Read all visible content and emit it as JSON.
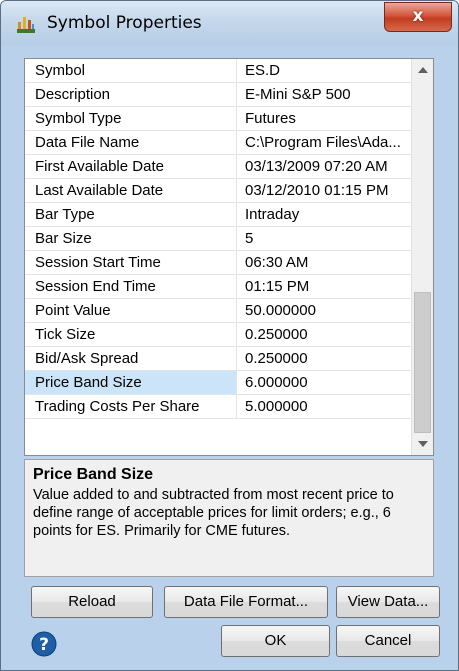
{
  "window": {
    "title": "Symbol Properties",
    "close_label": "x"
  },
  "properties": [
    {
      "name": "Symbol",
      "value": "ES.D"
    },
    {
      "name": "Description",
      "value": "E-Mini S&P 500"
    },
    {
      "name": "Symbol Type",
      "value": "Futures"
    },
    {
      "name": "Data File Name",
      "value": "C:\\Program Files\\Ada..."
    },
    {
      "name": "First Available Date",
      "value": "03/13/2009 07:20 AM"
    },
    {
      "name": "Last Available Date",
      "value": "03/12/2010 01:15 PM"
    },
    {
      "name": "Bar Type",
      "value": "Intraday"
    },
    {
      "name": "Bar Size",
      "value": "5"
    },
    {
      "name": "Session Start Time",
      "value": "06:30 AM"
    },
    {
      "name": "Session End Time",
      "value": "01:15 PM"
    },
    {
      "name": "Point Value",
      "value": "50.000000"
    },
    {
      "name": "Tick Size",
      "value": "0.250000"
    },
    {
      "name": "Bid/Ask Spread",
      "value": "0.250000"
    },
    {
      "name": "Price Band Size",
      "value": "6.000000"
    },
    {
      "name": "Trading Costs Per Share",
      "value": "5.000000"
    }
  ],
  "selected_index": 13,
  "scroll": {
    "thumb_start": 0.6,
    "thumb_fraction": 0.4
  },
  "description": {
    "title": "Price Band Size",
    "text": "Value added to and subtracted from most recent price to define range of acceptable prices for limit orders; e.g., 6 points for ES. Primarily for CME futures."
  },
  "buttons": {
    "reload": "Reload",
    "data_file_format": "Data File Format...",
    "view_data": "View Data...",
    "ok": "OK",
    "cancel": "Cancel"
  },
  "colors": {
    "selection": "#cce4f7",
    "help_icon": "#1f5fa8",
    "title_bar": "#c5d8ec"
  }
}
